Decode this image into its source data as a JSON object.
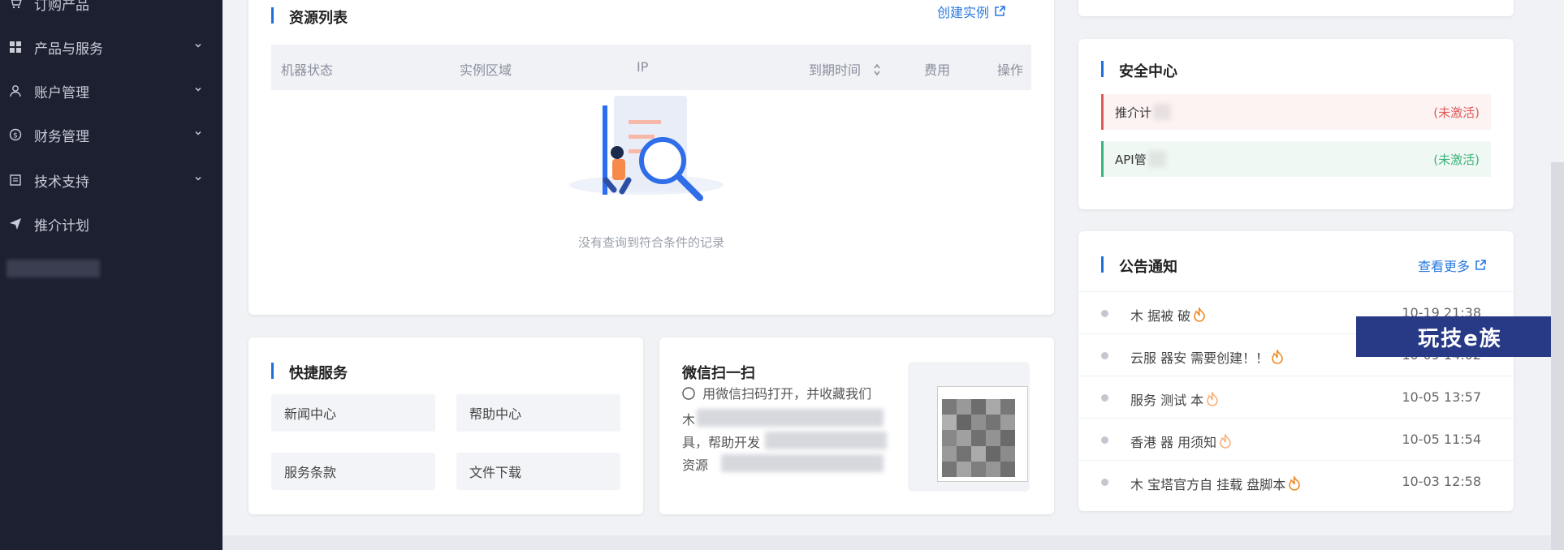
{
  "sidebar": {
    "items": [
      {
        "label": "订购产品",
        "icon": "cart-icon",
        "has_children": false
      },
      {
        "label": "产品与服务",
        "icon": "grid-icon",
        "has_children": true
      },
      {
        "label": "账户管理",
        "icon": "user-icon",
        "has_children": true
      },
      {
        "label": "财务管理",
        "icon": "coin-icon",
        "has_children": true
      },
      {
        "label": "技术支持",
        "icon": "document-icon",
        "has_children": true
      },
      {
        "label": "推介计划",
        "icon": "send-icon",
        "has_children": false
      }
    ]
  },
  "resources": {
    "title": "资源列表",
    "create_label": "创建实例",
    "columns": [
      "机器状态",
      "实例区域",
      "IP",
      "到期时间",
      "费用",
      "操作"
    ],
    "empty_text": "没有查询到符合条件的记录"
  },
  "quick": {
    "title": "快捷服务",
    "items": [
      "新闻中心",
      "帮助中心",
      "服务条款",
      "文件下载"
    ]
  },
  "wechat": {
    "title": "微信扫一扫",
    "line1": "用微信扫码打开，并收藏我们",
    "line2": "木",
    "line3": "具，帮助开发",
    "line4": "资源"
  },
  "security": {
    "title": "安全中心",
    "items": [
      {
        "label": "推介计",
        "status": "(未激活)",
        "color": "#e05a5a",
        "bg": "#fdf3f3"
      },
      {
        "label": "API管",
        "status": "(未激活)",
        "color": "#3bb37a",
        "bg": "#f0f8f4"
      }
    ]
  },
  "notices": {
    "title": "公告通知",
    "more_label": "查看更多",
    "items": [
      {
        "title": "木  据被    破",
        "time": "10-19 21:38",
        "hot": true
      },
      {
        "title": "云服  器安    需要创建！！",
        "time": "10-09 14:02",
        "hot": true
      },
      {
        "title": "服务  测试  本",
        "time": "10-05 13:57",
        "hot": true
      },
      {
        "title": "香港  器    用须知",
        "time": "10-05 11:54",
        "hot": true
      },
      {
        "title": "木  宝塔官方自  挂载  盘脚本",
        "time": "10-03 12:58",
        "hot": true
      }
    ]
  },
  "watermark": "玩技e族",
  "colors": {
    "accent": "#1e6fd9",
    "sidebar_bg": "#1c2031",
    "link": "#2979e0"
  }
}
